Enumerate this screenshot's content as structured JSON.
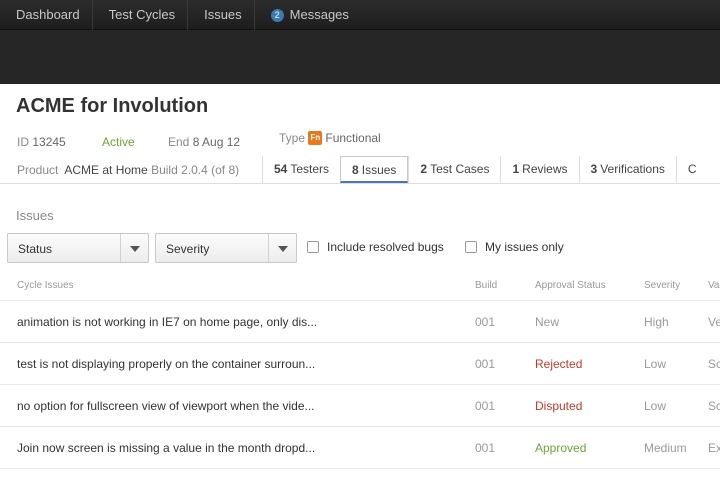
{
  "nav": {
    "items": [
      {
        "label": "Dashboard"
      },
      {
        "label": "Test Cycles"
      },
      {
        "label": "Issues"
      },
      {
        "label": "Messages",
        "badge": "2"
      }
    ]
  },
  "header": {
    "title": "ACME for Involution",
    "id_label": "ID",
    "id_value": "13245",
    "status": "Active",
    "end_label": "End",
    "end_value": "8 Aug 12",
    "type_label": "Type",
    "type_icon_text": "Fn",
    "type_value": "Functional",
    "product_label": "Product",
    "product_name": "ACME at Home",
    "build_info": "Build 2.0.4 (of 8)"
  },
  "tabs": [
    {
      "count": "54",
      "label": "Testers"
    },
    {
      "count": "8",
      "label": "Issues",
      "active": true
    },
    {
      "count": "2",
      "label": "Test Cases"
    },
    {
      "count": "1",
      "label": "Reviews"
    },
    {
      "count": "3",
      "label": "Verifications"
    },
    {
      "count": "",
      "label": "C"
    }
  ],
  "issues_section": {
    "heading": "Issues",
    "filters": {
      "status_select": "Status",
      "severity_select": "Severity",
      "include_resolved": "Include resolved bugs",
      "my_issues": "My issues only"
    },
    "columns": [
      "Cycle Issues",
      "Build",
      "Approval Status",
      "Severity",
      "Va"
    ],
    "rows": [
      {
        "title": "animation is not working in IE7 on home page, only dis...",
        "build": "001",
        "status": "New",
        "severity": "High",
        "v": "Ve"
      },
      {
        "title": "test is not displaying properly on the container surroun...",
        "build": "001",
        "status": "Rejected",
        "severity": "Low",
        "v": "Sc"
      },
      {
        "title": "no option for fullscreen view of viewport when the vide...",
        "build": "001",
        "status": "Disputed",
        "severity": "Low",
        "v": "Sc"
      },
      {
        "title": "Join now screen is missing a value in the month dropd...",
        "build": "001",
        "status": "Approved",
        "severity": "Medium",
        "v": "Ex"
      }
    ]
  },
  "colors": {
    "active": "#6aa536",
    "new": "#999999",
    "rejected": "#c0392b",
    "disputed": "#c0392b",
    "approved": "#6aa536",
    "badge": "#3a7bb0",
    "type_icon": "#e8791c"
  }
}
